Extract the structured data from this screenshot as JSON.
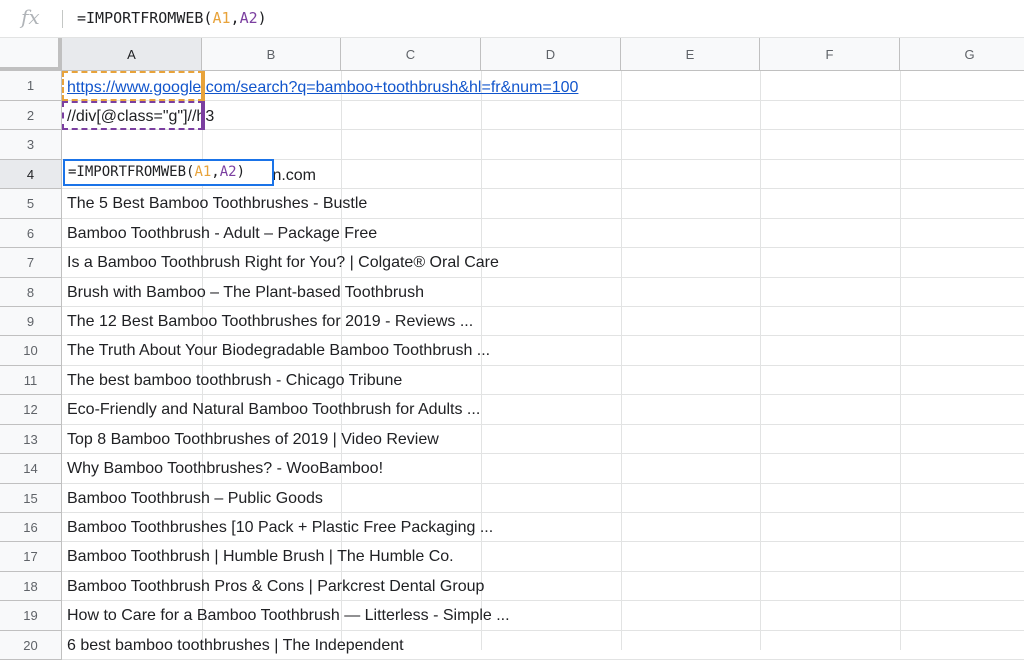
{
  "formula_bar": {
    "fx_label": "fx",
    "parts": [
      "=IMPORTFROMWEB(",
      "A1",
      ",",
      "A2",
      ")"
    ]
  },
  "columns": [
    "A",
    "B",
    "C",
    "D",
    "E",
    "F",
    "G"
  ],
  "selected_column": "A",
  "selected_row": "4",
  "rows": [
    "1",
    "2",
    "3",
    "4",
    "5",
    "6",
    "7",
    "8",
    "9",
    "10",
    "11",
    "12",
    "13",
    "14",
    "15",
    "16",
    "17",
    "18",
    "19",
    "20"
  ],
  "cells": {
    "a1": "https://www.google.com/search?q=bamboo+toothbrush&hl=fr&num=100",
    "a2": "//div[@class=\"g\"]//h3",
    "a4_overflow": "hbrush Adult Size ... - Amazon.com",
    "results": [
      "The 5 Best Bamboo Toothbrushes - Bustle",
      "Bamboo Toothbrush - Adult – Package Free",
      "Is a Bamboo Toothbrush Right for You? | Colgate® Oral Care",
      "Brush with Bamboo – The Plant-based Toothbrush",
      "The 12 Best Bamboo Toothbrushes for 2019 - Reviews ...",
      "The Truth About Your Biodegradable Bamboo Toothbrush ...",
      "The best bamboo toothbrush - Chicago Tribune",
      "Eco-Friendly and Natural Bamboo Toothbrush for Adults ...",
      "Top 8 Bamboo Toothbrushes of 2019 | Video Review",
      "Why Bamboo Toothbrushes? - WooBamboo!",
      "Bamboo Toothbrush – Public Goods",
      "Bamboo Toothbrushes [10 Pack + Plastic Free Packaging ...",
      "Bamboo Toothbrush | Humble Brush | The Humble Co.",
      "Bamboo Toothbrush Pros & Cons | Parkcrest Dental Group",
      "How to Care for a Bamboo Toothbrush — Litterless - Simple ...",
      "6 best bamboo toothbrushes | The Independent"
    ]
  },
  "editor": {
    "parts": [
      "=IMPORTFROMWEB(",
      "A1",
      ",",
      "A2",
      ")"
    ]
  },
  "colors": {
    "ref_a1": "#e8a33b",
    "ref_a2": "#7b3fa0",
    "edit_border": "#1a73e8",
    "link": "#1155cc"
  }
}
